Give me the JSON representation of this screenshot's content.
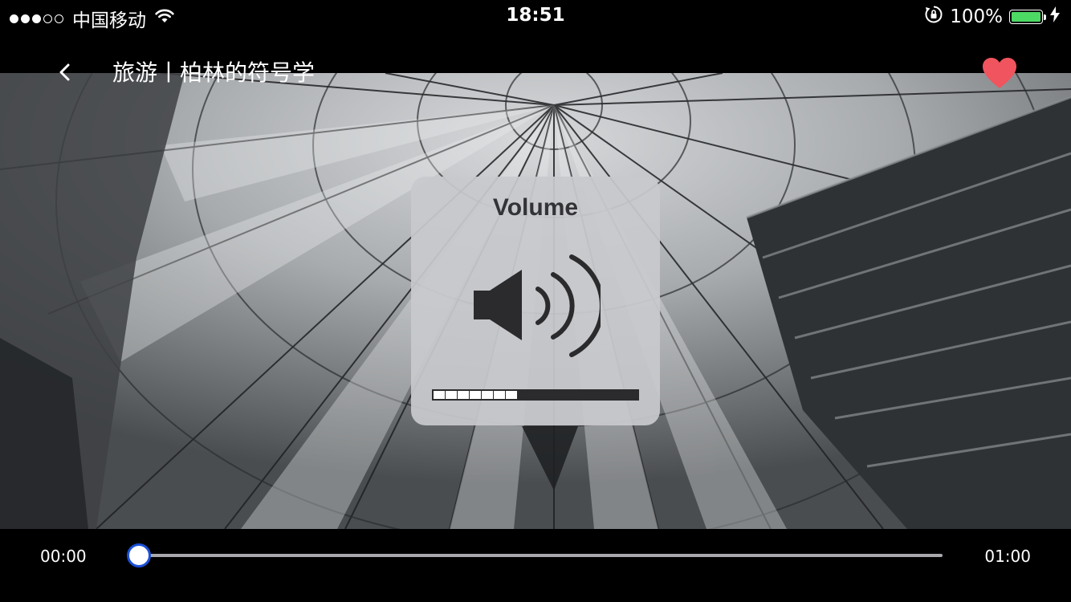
{
  "status_bar": {
    "carrier": "中国移动",
    "time": "18:51",
    "battery_percent": "100%",
    "signal_strength": 3,
    "signal_max": 5,
    "battery_color": "#4cd964"
  },
  "header": {
    "title": "旅游丨柏林的符号学",
    "favorite_color": "#f0545e"
  },
  "volume_hud": {
    "title": "Volume",
    "level": 0.44
  },
  "player": {
    "current_time": "00:00",
    "total_time": "01:00",
    "progress": 0,
    "thumb_border_color": "#1a4fd6"
  }
}
